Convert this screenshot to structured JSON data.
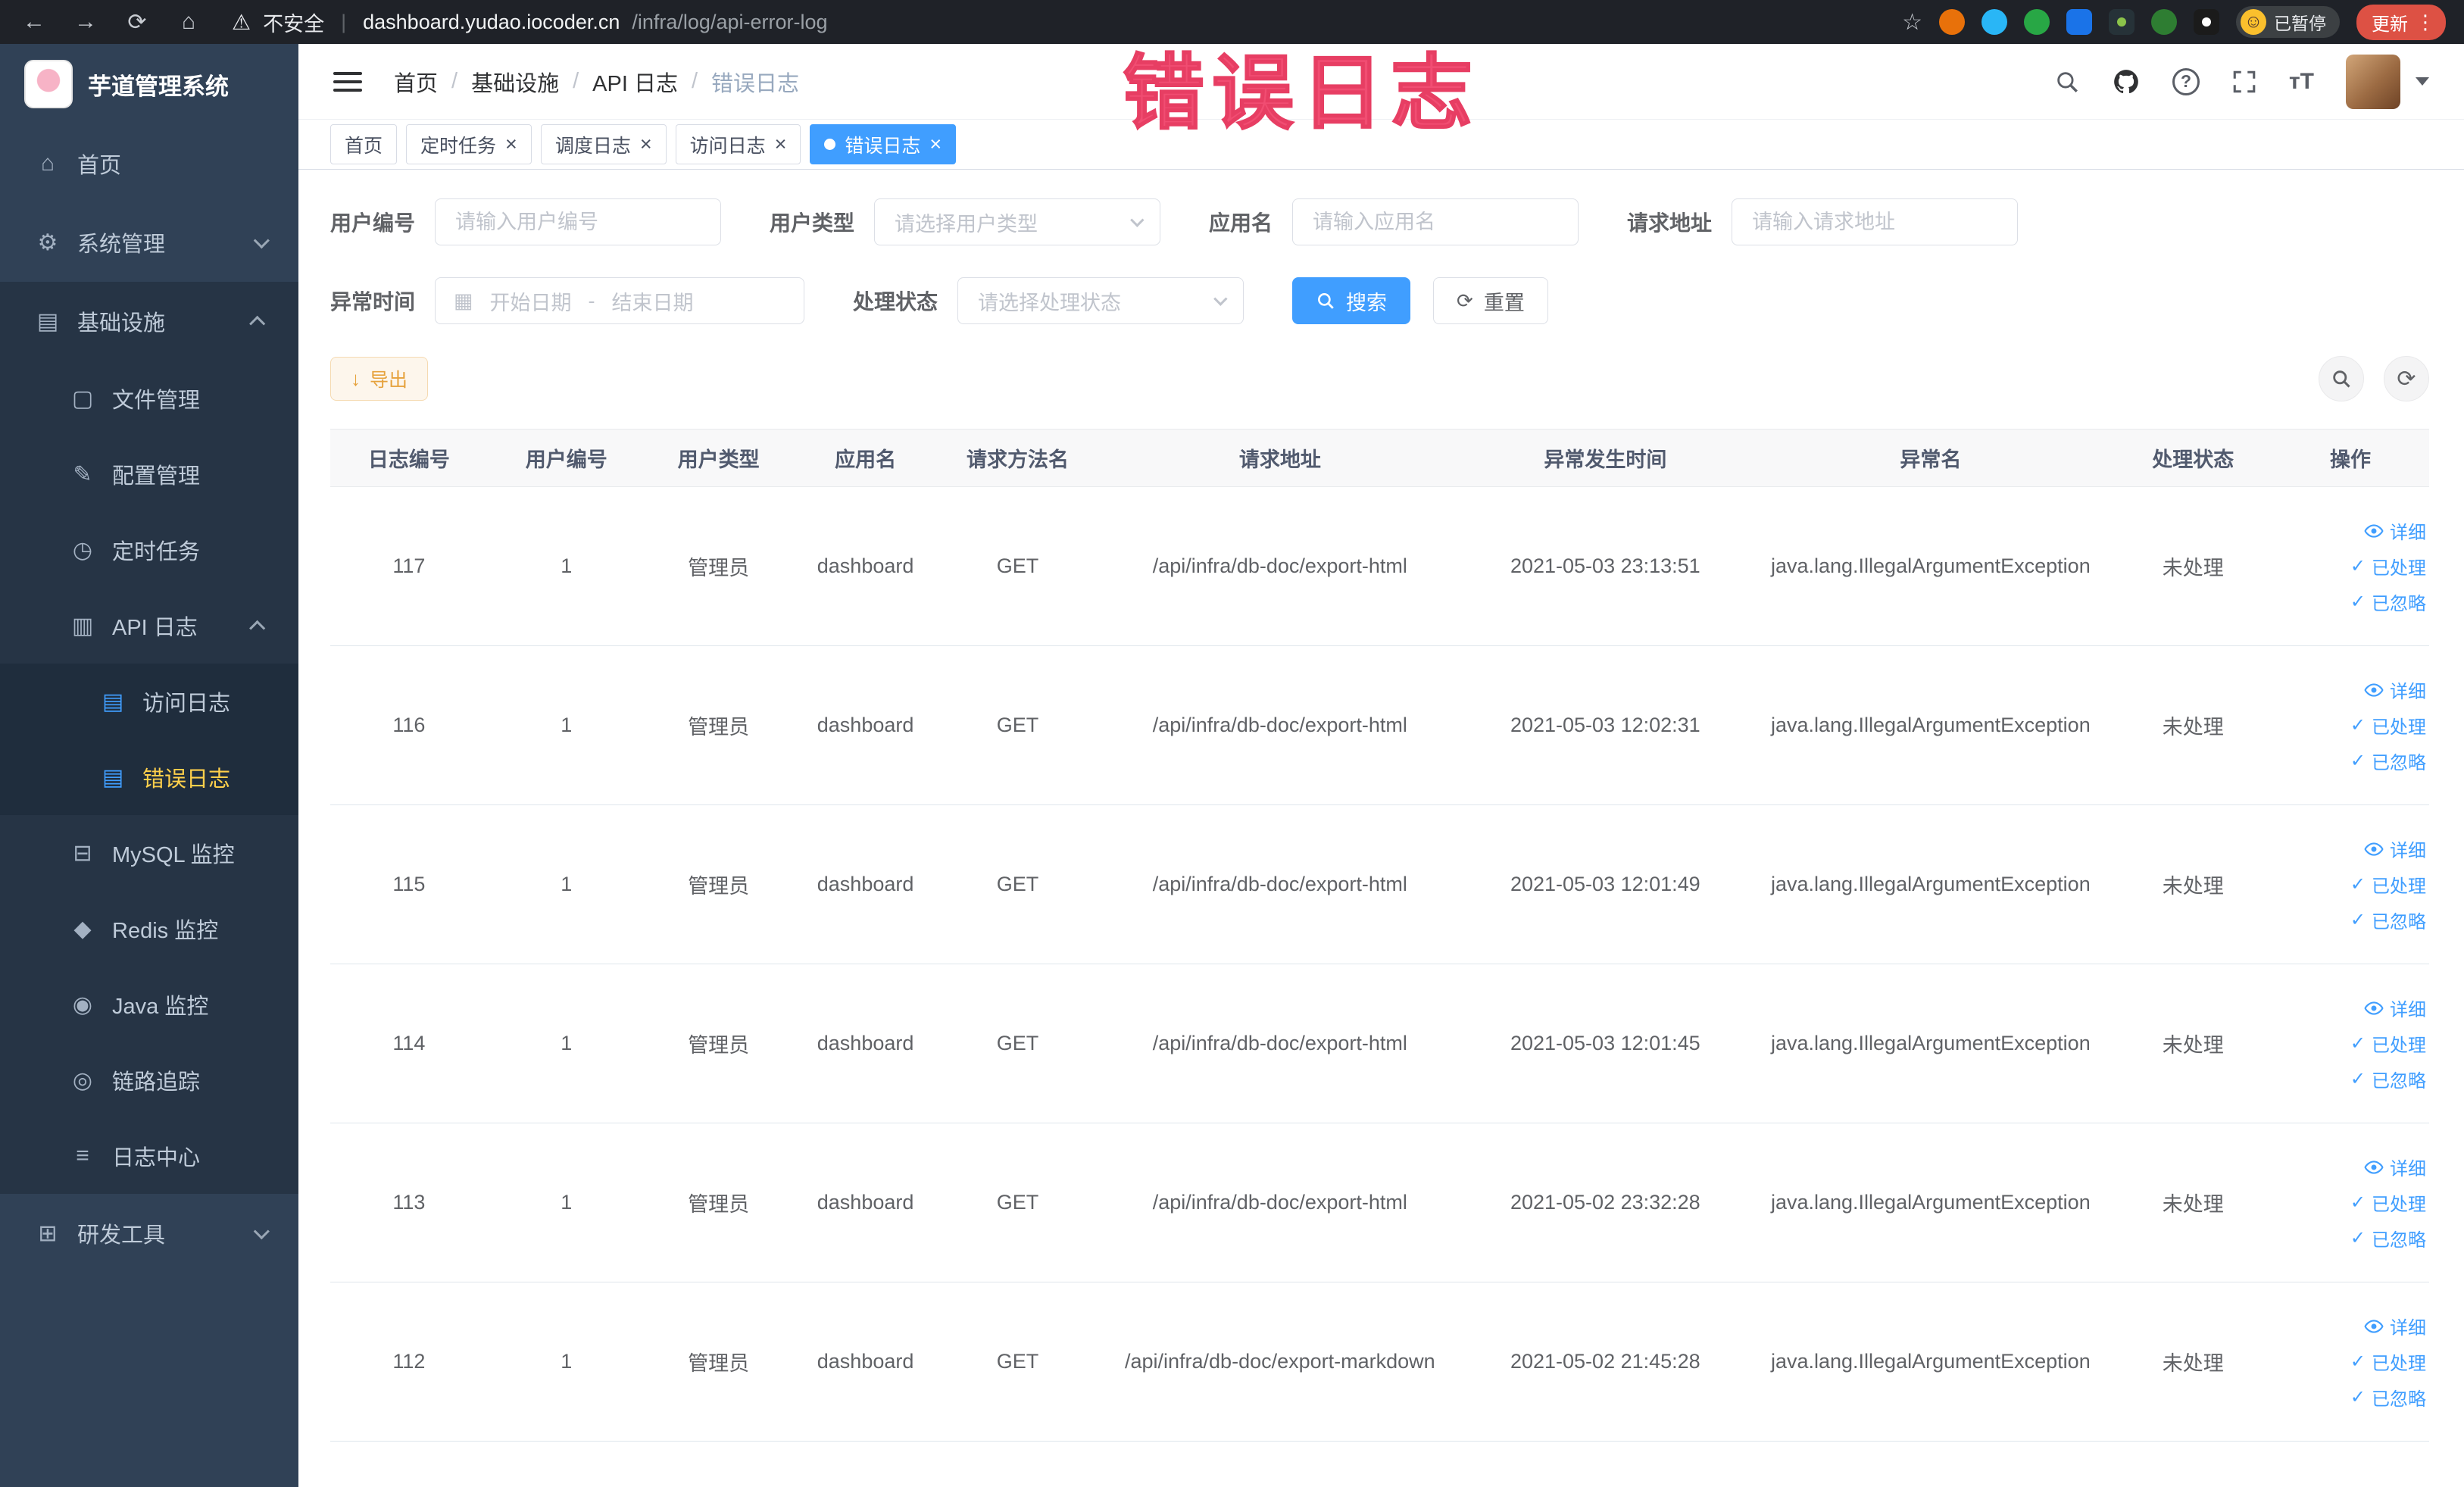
{
  "watermark": "错误日志",
  "browser": {
    "security_label": "不安全",
    "url_host": "dashboard.yudao.iocoder.cn",
    "url_path": "/infra/log/api-error-log",
    "paused_badge": "已暂停",
    "update_label": "更新"
  },
  "sidebar": {
    "logo_title": "芋道管理系统",
    "items": [
      {
        "label": "首页",
        "icon": "home-icon",
        "depth": 1
      },
      {
        "label": "系统管理",
        "icon": "gear-icon",
        "depth": 1,
        "arrow": "down"
      },
      {
        "label": "基础设施",
        "icon": "infrastructure-icon",
        "depth": 1,
        "arrow": "up",
        "open": true
      },
      {
        "label": "文件管理",
        "icon": "file-icon",
        "depth": 2
      },
      {
        "label": "配置管理",
        "icon": "config-icon",
        "depth": 2
      },
      {
        "label": "定时任务",
        "icon": "timer-icon",
        "depth": 2
      },
      {
        "label": "API 日志",
        "icon": "api-log-icon",
        "depth": 2,
        "arrow": "up"
      },
      {
        "label": "访问日志",
        "icon": "access-log-icon",
        "depth": 3,
        "blue_icon": true
      },
      {
        "label": "错误日志",
        "icon": "error-log-icon",
        "depth": 3,
        "blue_icon": true,
        "active": true
      },
      {
        "label": "MySQL 监控",
        "icon": "mysql-icon",
        "depth": 2
      },
      {
        "label": "Redis 监控",
        "icon": "redis-icon",
        "depth": 2
      },
      {
        "label": "Java 监控",
        "icon": "java-icon",
        "depth": 2
      },
      {
        "label": "链路追踪",
        "icon": "trace-icon",
        "depth": 2
      },
      {
        "label": "日志中心",
        "icon": "log-center-icon",
        "depth": 2
      },
      {
        "label": "研发工具",
        "icon": "devtools-icon",
        "depth": 1,
        "arrow": "down"
      }
    ]
  },
  "header": {
    "breadcrumb": [
      "首页",
      "基础设施",
      "API 日志",
      "错误日志"
    ]
  },
  "tabs": [
    {
      "label": "首页",
      "closable": false,
      "active": false
    },
    {
      "label": "定时任务",
      "closable": true,
      "active": false
    },
    {
      "label": "调度日志",
      "closable": true,
      "active": false
    },
    {
      "label": "访问日志",
      "closable": true,
      "active": false
    },
    {
      "label": "错误日志",
      "closable": true,
      "active": true
    }
  ],
  "filters": {
    "user_id": {
      "label": "用户编号",
      "placeholder": "请输入用户编号"
    },
    "user_type": {
      "label": "用户类型",
      "placeholder": "请选择用户类型"
    },
    "app_name": {
      "label": "应用名",
      "placeholder": "请输入应用名"
    },
    "request_url": {
      "label": "请求地址",
      "placeholder": "请输入请求地址"
    },
    "exception_time": {
      "label": "异常时间",
      "start_placeholder": "开始日期",
      "separator": "-",
      "end_placeholder": "结束日期"
    },
    "process_status": {
      "label": "处理状态",
      "placeholder": "请选择处理状态"
    },
    "search_label": "搜索",
    "reset_label": "重置"
  },
  "toolbar": {
    "export_label": "导出"
  },
  "table": {
    "columns": [
      "日志编号",
      "用户编号",
      "用户类型",
      "应用名",
      "请求方法名",
      "请求地址",
      "异常发生时间",
      "异常名",
      "处理状态",
      "操作"
    ],
    "row_actions": [
      {
        "label": "详细",
        "icon": "eye-icon",
        "name": "detail-link"
      },
      {
        "label": "已处理",
        "icon": "check-icon",
        "name": "mark-processed-link"
      },
      {
        "label": "已忽略",
        "icon": "check-icon",
        "name": "mark-ignored-link"
      }
    ],
    "rows": [
      {
        "id": "117",
        "user_id": "1",
        "user_type": "管理员",
        "app_name": "dashboard",
        "method": "GET",
        "url": "/api/infra/db-doc/export-html",
        "time": "2021-05-03 23:13:51",
        "exception": "java.lang.IllegalArgumentException",
        "status": "未处理"
      },
      {
        "id": "116",
        "user_id": "1",
        "user_type": "管理员",
        "app_name": "dashboard",
        "method": "GET",
        "url": "/api/infra/db-doc/export-html",
        "time": "2021-05-03 12:02:31",
        "exception": "java.lang.IllegalArgumentException",
        "status": "未处理"
      },
      {
        "id": "115",
        "user_id": "1",
        "user_type": "管理员",
        "app_name": "dashboard",
        "method": "GET",
        "url": "/api/infra/db-doc/export-html",
        "time": "2021-05-03 12:01:49",
        "exception": "java.lang.IllegalArgumentException",
        "status": "未处理"
      },
      {
        "id": "114",
        "user_id": "1",
        "user_type": "管理员",
        "app_name": "dashboard",
        "method": "GET",
        "url": "/api/infra/db-doc/export-html",
        "time": "2021-05-03 12:01:45",
        "exception": "java.lang.IllegalArgumentException",
        "status": "未处理"
      },
      {
        "id": "113",
        "user_id": "1",
        "user_type": "管理员",
        "app_name": "dashboard",
        "method": "GET",
        "url": "/api/infra/db-doc/export-html",
        "time": "2021-05-02 23:32:28",
        "exception": "java.lang.IllegalArgumentException",
        "status": "未处理"
      },
      {
        "id": "112",
        "user_id": "1",
        "user_type": "管理员",
        "app_name": "dashboard",
        "method": "GET",
        "url": "/api/infra/db-doc/export-markdown",
        "time": "2021-05-02 21:45:28",
        "exception": "java.lang.IllegalArgumentException",
        "status": "未处理"
      }
    ]
  }
}
